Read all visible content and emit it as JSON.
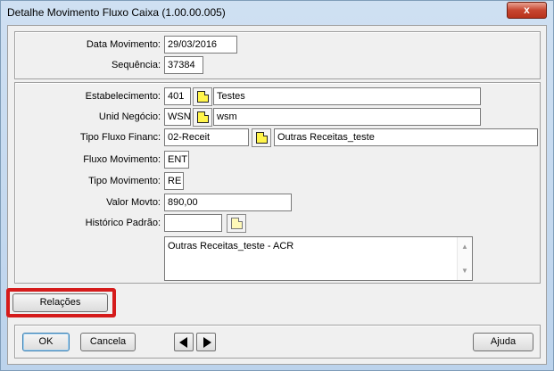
{
  "window": {
    "title": "Detalhe Movimento Fluxo Caixa (1.00.00.005)",
    "close_label": "x"
  },
  "header_group": {
    "data_movimento": {
      "label": "Data Movimento:",
      "value": "29/03/2016"
    },
    "sequencia": {
      "label": "Sequência:",
      "value": "37384"
    }
  },
  "details_group": {
    "estabelecimento": {
      "label": "Estabelecimento:",
      "code": "401",
      "description": "Testes"
    },
    "unid_negocio": {
      "label": "Unid Negócio:",
      "code": "WSN",
      "description": "wsm"
    },
    "tipo_fluxo": {
      "label": "Tipo Fluxo Financ:",
      "code": "02-Receit",
      "description": "Outras Receitas_teste"
    },
    "fluxo_movimento": {
      "label": "Fluxo Movimento:",
      "value": "ENT"
    },
    "tipo_movimento": {
      "label": "Tipo Movimento:",
      "value": "RE"
    },
    "valor_movto": {
      "label": "Valor Movto:",
      "value": "890,00"
    },
    "historico_padrao": {
      "label": "Histórico Padrão:",
      "value": ""
    },
    "historico_text": "Outras Receitas_teste - ACR"
  },
  "buttons": {
    "relacoes": "Relações",
    "ok": "OK",
    "cancela": "Cancela",
    "ajuda": "Ajuda"
  },
  "colors": {
    "highlight": "#d51b1b",
    "zoom_icon": "#fff44a"
  },
  "icons": {
    "zoom": "zoom-icon",
    "previous": "previous-icon",
    "next": "next-icon"
  }
}
